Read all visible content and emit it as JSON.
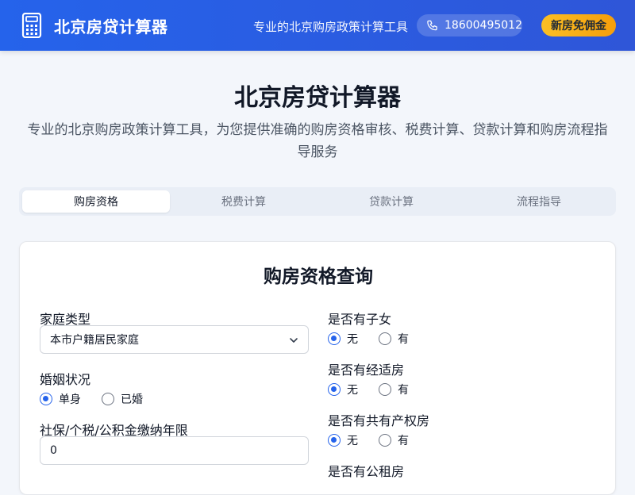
{
  "header": {
    "brand": "北京房贷计算器",
    "slogan": "专业的北京购房政策计算工具",
    "phone": "18600495012",
    "promo_button": "新房免佣金",
    "logo_icon": "calculator-icon",
    "phone_icon": "phone-icon"
  },
  "hero": {
    "title": "北京房贷计算器",
    "subtitle": "专业的北京购房政策计算工具，为您提供准确的购房资格审核、税费计算、贷款计算和购房流程指导服务"
  },
  "tabs": [
    {
      "label": "购房资格",
      "active": true
    },
    {
      "label": "税费计算",
      "active": false
    },
    {
      "label": "贷款计算",
      "active": false
    },
    {
      "label": "流程指导",
      "active": false
    }
  ],
  "card": {
    "title": "购房资格查询",
    "family_type": {
      "label": "家庭类型",
      "value": "本市户籍居民家庭"
    },
    "marital_status": {
      "label": "婚姻状况",
      "options": [
        "单身",
        "已婚"
      ],
      "selected": "单身"
    },
    "social_security": {
      "label": "社保/个税/公积金缴纳年限",
      "value": "0"
    },
    "has_children": {
      "label": "是否有子女",
      "options": [
        "无",
        "有"
      ],
      "selected": "无"
    },
    "has_affordable_housing": {
      "label": "是否有经适房",
      "options": [
        "无",
        "有"
      ],
      "selected": "无"
    },
    "has_shared_property": {
      "label": "是否有共有产权房",
      "options": [
        "无",
        "有"
      ],
      "selected": "无"
    },
    "has_public_rental": {
      "label": "是否有公租房"
    }
  },
  "colors": {
    "header_bg": "#2563eb",
    "accent": "#2563eb",
    "promo": "#fbbf24"
  }
}
